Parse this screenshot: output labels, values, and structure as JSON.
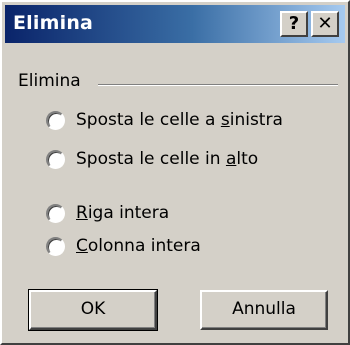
{
  "window": {
    "title": "Elimina",
    "help_button": "?",
    "close_button": "✕"
  },
  "group": {
    "label": "Elimina",
    "options": [
      {
        "pre": "Sposta le celle a ",
        "mnemonic": "s",
        "post": "inistra",
        "selected": false
      },
      {
        "pre": "Sposta le celle in ",
        "mnemonic": "a",
        "post": "lto",
        "selected": false
      },
      {
        "pre": "",
        "mnemonic": "R",
        "post": "iga intera",
        "selected": false
      },
      {
        "pre": "",
        "mnemonic": "C",
        "post": "olonna intera",
        "selected": false
      }
    ]
  },
  "buttons": {
    "ok": "OK",
    "cancel": "Annulla"
  },
  "colors": {
    "titlebar_start": "#0a246a",
    "titlebar_end": "#a6caf0",
    "face": "#d4d0c8"
  }
}
